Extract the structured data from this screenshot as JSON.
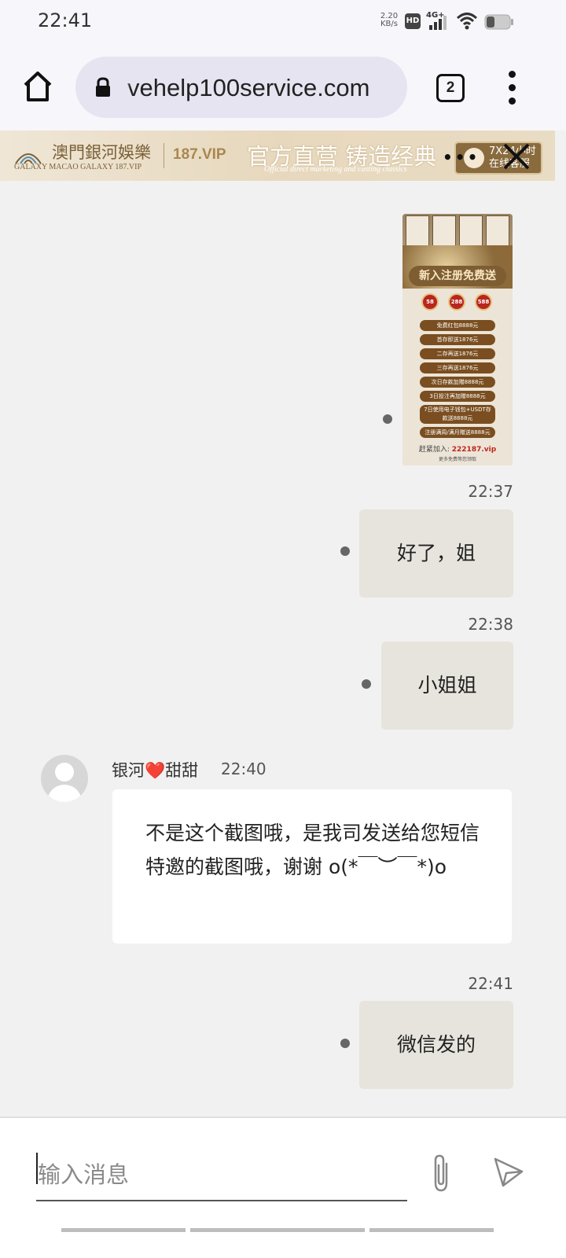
{
  "status_bar": {
    "time": "22:41",
    "net_speed_value": "2.20",
    "net_speed_unit": "KB/s",
    "hd_label": "HD",
    "signal_label": "4G+"
  },
  "browser": {
    "url": "vehelp100service.com",
    "tab_count": "2"
  },
  "banner": {
    "brand_cn": "澳門銀河娛樂",
    "brand_en": "GALAXY  MACAO GALAXY 187.VIP",
    "vip": "187.VIP",
    "slogan": "官方直营  铸造经典",
    "slogan_en": "Official direct marketing and casting classics",
    "service_line1": "7X24小时",
    "service_line2": "在线客服",
    "colors": {
      "brand": "#7b6139",
      "service_button": "#8a6b3e"
    }
  },
  "promo_image": {
    "title": "新入注册免费送",
    "coins": [
      "58",
      "288",
      "588"
    ],
    "rows": [
      "免费红包8888元",
      "首存即送1876元",
      "二存再送1876元",
      "三存再送1876元",
      "次日存款加赠8888元",
      "3日投注再加赠8888元",
      "7日使用电子钱包+USDT存款送8888元",
      "注册满周/满月赠送8888元"
    ],
    "footer_label": "赶紧加入:",
    "footer_link": "222187.vip",
    "footer_note": "更多免费等您领取"
  },
  "messages": [
    {
      "time": "22:37",
      "text": "好了，姐"
    },
    {
      "time": "22:38",
      "text": "小姐姐"
    },
    {
      "sender": "银河❤️甜甜",
      "time": "22:40",
      "text": "不是这个截图哦，是我司发送给您短信特邀的截图哦，谢谢 o(*￣︶￣*)o"
    },
    {
      "time": "22:41",
      "text": "微信发的"
    }
  ],
  "composer": {
    "placeholder": "输入消息"
  }
}
